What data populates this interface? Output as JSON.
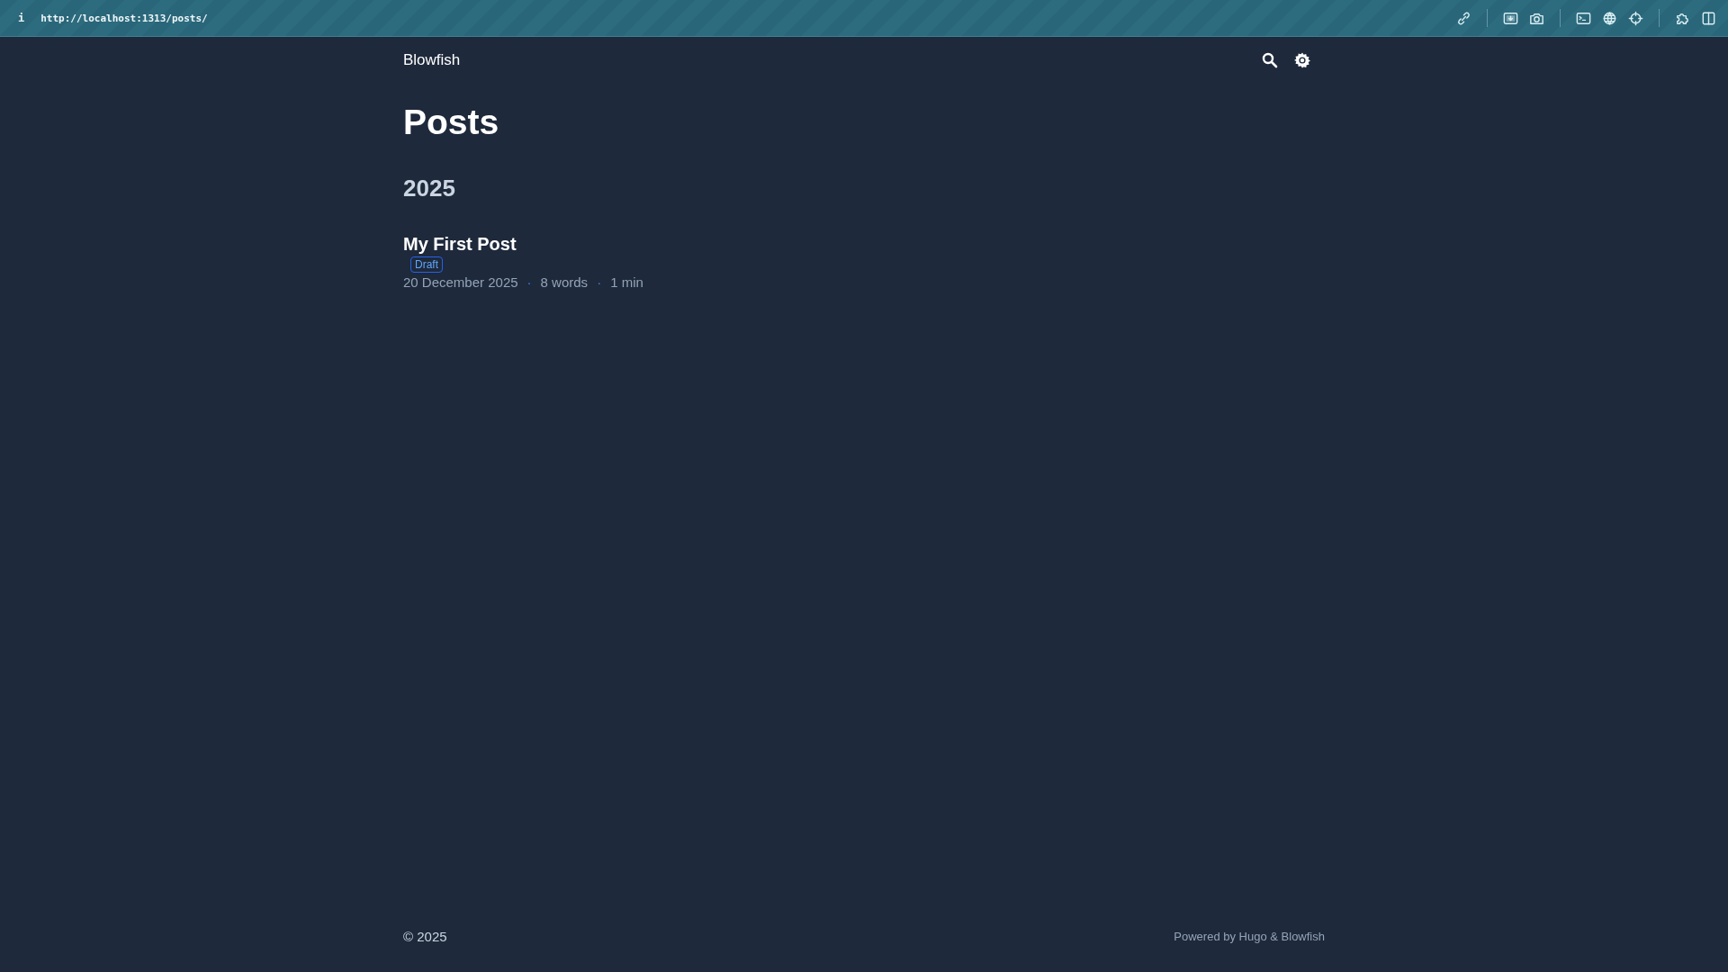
{
  "browser_bar": {
    "info": "i",
    "url": "http://localhost:1313/posts/",
    "tools": [
      {
        "kind": "link"
      },
      {
        "kind": "divider"
      },
      {
        "kind": "screenshot"
      },
      {
        "kind": "camera"
      },
      {
        "kind": "divider"
      },
      {
        "kind": "terminal"
      },
      {
        "kind": "globe"
      },
      {
        "kind": "crosshair"
      },
      {
        "kind": "divider"
      },
      {
        "kind": "puzzle"
      },
      {
        "kind": "split"
      }
    ]
  },
  "header": {
    "site_title": "Blowfish",
    "actions": [
      {
        "kind": "search"
      },
      {
        "kind": "appearance"
      }
    ]
  },
  "page_title": "Posts",
  "groups": [
    {
      "year": "2025",
      "posts": [
        {
          "title": "My First Post",
          "badges": [
            "Draft"
          ],
          "meta": [
            {
              "kind": "text",
              "text": "20 December 2025"
            },
            {
              "kind": "separator",
              "text": "·"
            },
            {
              "kind": "text",
              "text": "8 words"
            },
            {
              "kind": "separator",
              "text": "·"
            },
            {
              "kind": "text",
              "text": "1 min"
            }
          ]
        }
      ]
    }
  ],
  "footer": {
    "copyright": "© 2025",
    "powered_by": "Powered by",
    "links": [
      "Hugo",
      "Blowfish"
    ],
    "joiner": "&"
  }
}
